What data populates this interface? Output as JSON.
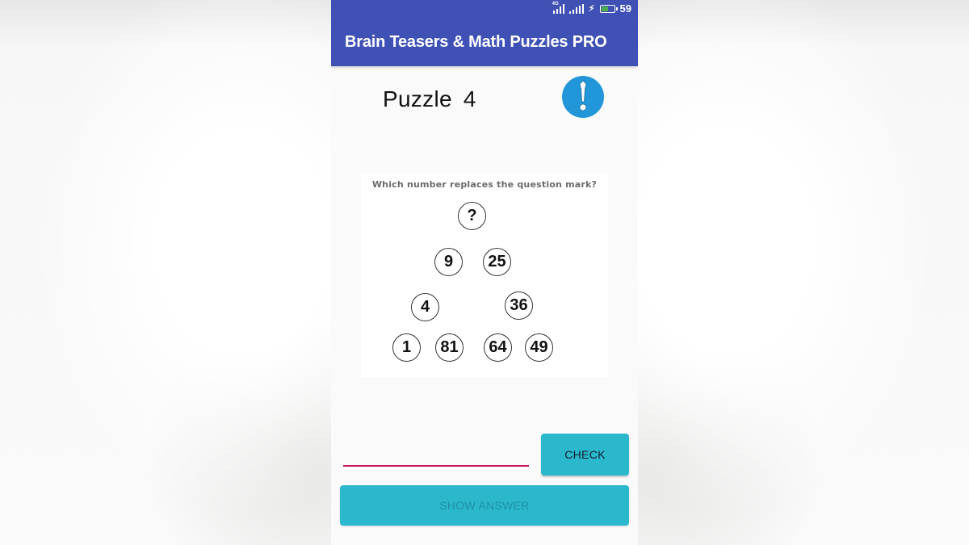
{
  "status_bar": {
    "network_label": "4G",
    "battery_percent": "59",
    "battery_level": 0.59,
    "charging": true
  },
  "app_bar": {
    "title": "Brain Teasers & Math Puzzles PRO",
    "color": "#3f51b5"
  },
  "puzzle": {
    "label": "Puzzle",
    "number": "4",
    "hint_icon": "exclamation-icon",
    "question": "Which number replaces the question mark?",
    "nodes": [
      {
        "id": "top",
        "value": "?"
      },
      {
        "id": "row2-left",
        "value": "9"
      },
      {
        "id": "row2-right",
        "value": "25"
      },
      {
        "id": "row3-left",
        "value": "4"
      },
      {
        "id": "row3-right",
        "value": "36"
      },
      {
        "id": "row4-a",
        "value": "1"
      },
      {
        "id": "row4-b",
        "value": "81"
      },
      {
        "id": "row4-c",
        "value": "64"
      },
      {
        "id": "row4-d",
        "value": "49"
      }
    ]
  },
  "answer": {
    "value": "",
    "placeholder": "",
    "underline_color": "#c2185b"
  },
  "buttons": {
    "check_label": "CHECK",
    "show_answer_label": "SHOW ANSWER",
    "color": "#2bb8cd"
  }
}
